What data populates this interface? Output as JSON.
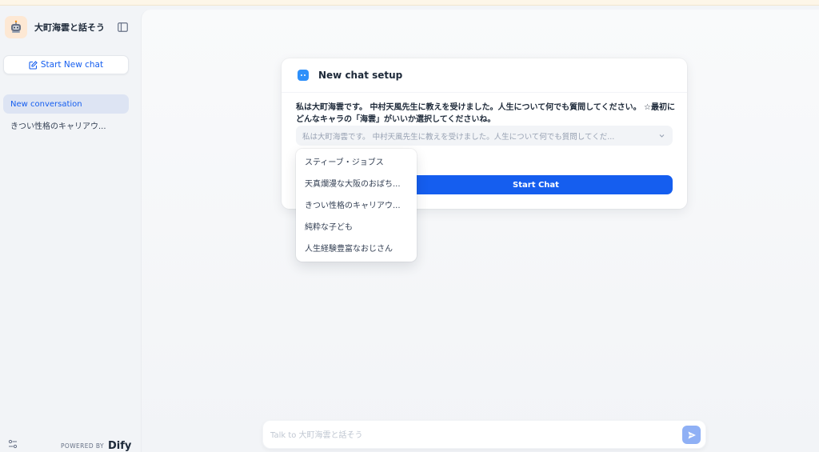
{
  "sidebar": {
    "app_title": "大町海雲と話そう",
    "new_chat_label": "Start New chat",
    "conversations": [
      {
        "label": "New conversation",
        "active": true
      },
      {
        "label": "きつい性格のキャリアウ...",
        "active": false
      }
    ],
    "footer": {
      "powered_by": "POWERED BY",
      "brand": "Dify"
    }
  },
  "setup_card": {
    "title": "New chat setup",
    "prompt": "私は大町海雲です。 中村天風先生に教えを受けました。人生について何でも質問してください。 ☆最初にどんなキャラの「海雲」がいいか選択してくださいね。",
    "select_value": "私は大町海雲です。 中村天風先生に教えを受けました。人生について何でも質問してくだ...",
    "start_button": "Start Chat"
  },
  "dropdown": {
    "options": [
      "スティーブ・ジョブス",
      "天真爛漫な大阪のおばち...",
      "きつい性格のキャリアウ...",
      "純粋な子ども",
      "人生経験豊富なおじさん"
    ]
  },
  "chat_input": {
    "placeholder": "Talk to 大町海雲と話そう"
  },
  "colors": {
    "accent": "#155eef",
    "sidebar_bg": "#f2f4f7",
    "active_item_bg": "#dde4f3",
    "send_button": "#8fb0f5"
  },
  "icons": {
    "brand": "robot-avatar-icon",
    "collapse": "sidebar-toggle-icon",
    "new_chat": "edit-icon",
    "settings": "sliders-icon",
    "card": "chat-bubble-icon",
    "select": "chevron-down-icon",
    "send": "send-icon"
  }
}
